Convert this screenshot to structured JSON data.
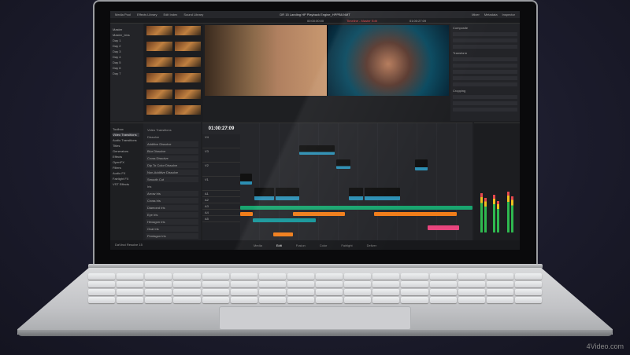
{
  "app": {
    "title": "DR 15 Landing HP Playback Engine_HPPB8.NMT",
    "logo_text": "DaVinci Resolve 15"
  },
  "topbar": {
    "left": [
      "Media Pool",
      "Effects Library",
      "Edit Index",
      "Sound Library"
    ],
    "right": [
      "Mixer",
      "Metadata",
      "Inspector"
    ]
  },
  "viewer": {
    "source_tc": "00:00:00:00",
    "record_tc": "01:00:27:09",
    "record_label": "Timeline - Master Edit"
  },
  "bins": [
    "Master",
    "Master_bins",
    "Day 1",
    "Day 2",
    "Day 3",
    "Day 4",
    "Day 5",
    "Day 6",
    "Day 7"
  ],
  "inspector": {
    "sections": [
      "Composite",
      "Transform",
      "Cropping"
    ]
  },
  "effects": {
    "categories": [
      "Toolbox",
      "Video Transitions",
      "Audio Transitions",
      "Titles",
      "Generators",
      "Effects",
      "OpenFX",
      "Filters",
      "Audio FX",
      "Fairlight FX",
      "VST Effects"
    ],
    "selected_category": "Video Transitions",
    "header": "Video Transitions",
    "groups": [
      {
        "name": "Dissolve",
        "items": [
          "Additive Dissolve",
          "Blur Dissolve",
          "Cross Dissolve",
          "Dip To Color Dissolve",
          "Non-Additive Dissolve",
          "Smooth Cut"
        ]
      },
      {
        "name": "Iris",
        "items": [
          "Arrow Iris",
          "Cross Iris",
          "Diamond Iris",
          "Eye Iris",
          "Hexagon Iris",
          "Oval Iris",
          "Pentagon Iris",
          "Triangle Iris"
        ]
      },
      {
        "name": "Motion",
        "items": []
      }
    ],
    "favorites_label": "Favorites"
  },
  "timeline": {
    "timecode": "01:00:27:09",
    "name": "Timeline - Master Edit",
    "tracks": [
      "V4",
      "V3",
      "V2",
      "V1",
      "A1",
      "A2",
      "A3",
      "A4",
      "A5"
    ]
  },
  "pages": [
    {
      "label": "Media"
    },
    {
      "label": "Edit",
      "active": true
    },
    {
      "label": "Fusion"
    },
    {
      "label": "Color"
    },
    {
      "label": "Fairlight"
    },
    {
      "label": "Deliver"
    }
  ],
  "colors": {
    "accent_red": "#e5484d",
    "clip_blue": "#2d8fb3",
    "clip_green": "#19a56f",
    "clip_orange": "#f07d1a",
    "clip_pink": "#e8457e"
  },
  "watermark": "4Video.com"
}
